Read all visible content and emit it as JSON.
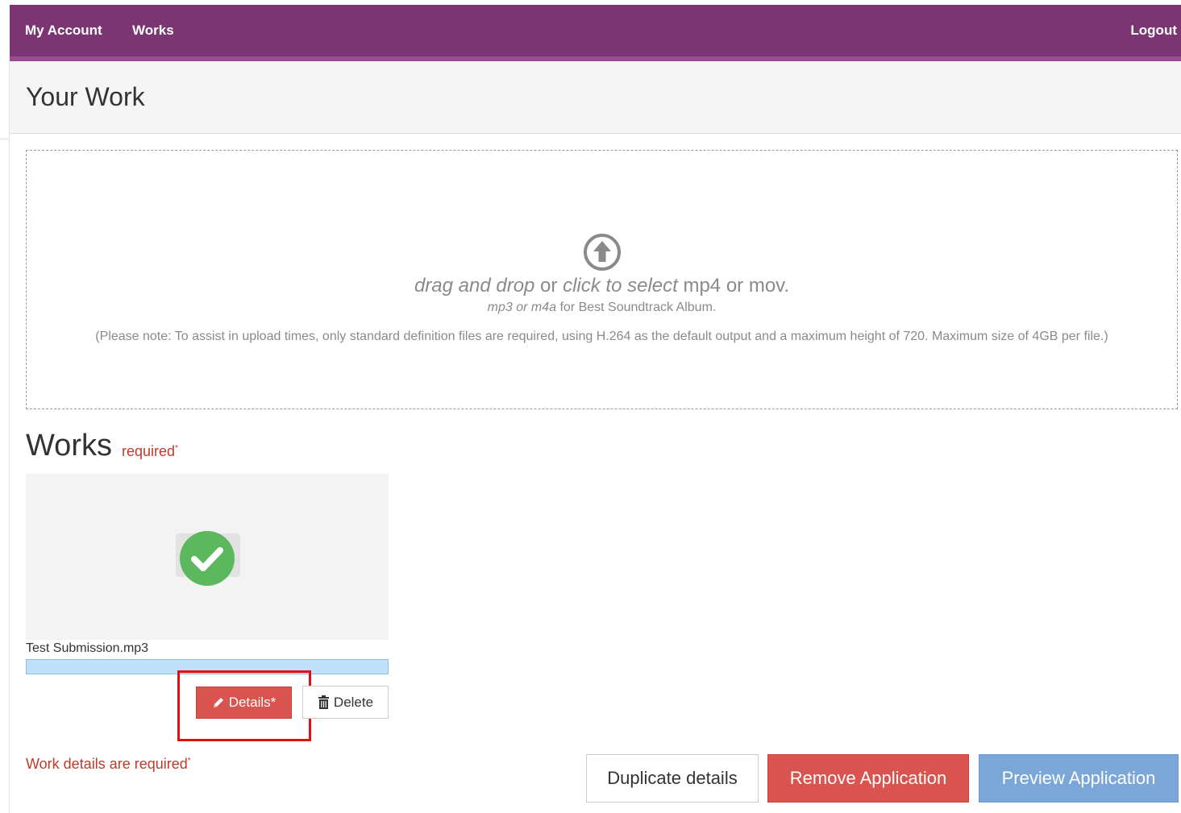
{
  "nav": {
    "my_account": "My Account",
    "works": "Works",
    "logout": "Logout"
  },
  "header": {
    "title": "Your Work"
  },
  "dropzone": {
    "drag_text": "drag and drop",
    "or_text": " or ",
    "click_text": "click to select",
    "formats_text": " mp4 or mov.",
    "sub_formats": "mp3 or m4a",
    "sub_suffix": " for Best Soundtrack Album.",
    "note": "(Please note: To assist in upload times, only standard definition files are required, using H.264 as the default output and a maximum height of 720. Maximum size of 4GB per file.)"
  },
  "works": {
    "title": "Works",
    "required_label": "required",
    "required_mark": "*",
    "file_name": "Test Submission.mp3",
    "upload_progress": 1.0,
    "details_label": "Details*",
    "delete_label": "Delete",
    "error_text": "Work details are required",
    "error_mark": "*"
  },
  "actions": {
    "duplicate": "Duplicate details",
    "remove": "Remove Application",
    "preview": "Preview Application"
  },
  "colors": {
    "navbar": "#7b3573",
    "danger": "#d9534f",
    "primary_light": "#7ba7d8",
    "success": "#5cb85c",
    "highlight": "#e01010"
  },
  "icons": {
    "upload": "upload-circle-icon",
    "check": "check-circle-icon",
    "pencil": "pencil-icon",
    "trash": "trash-icon"
  }
}
